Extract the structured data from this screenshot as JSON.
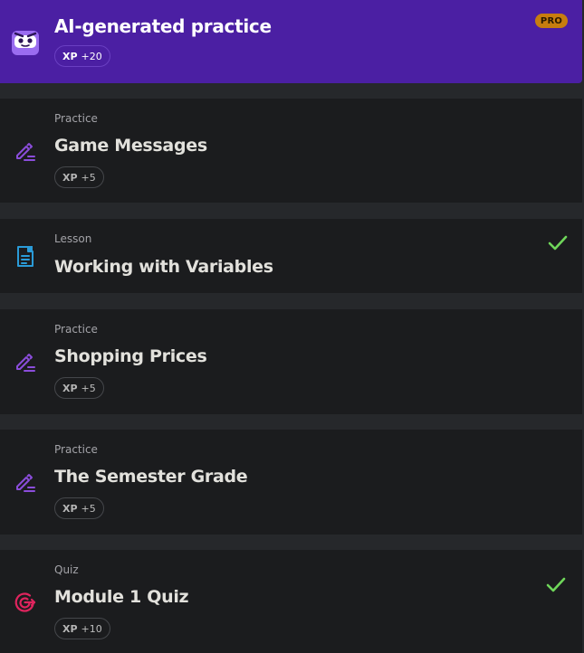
{
  "pro_card": {
    "title": "AI-generated practice",
    "xp_word": "XP",
    "xp_value": "+20",
    "pro_badge": "PRO",
    "icon": "robot-mascot-icon"
  },
  "items": [
    {
      "type": "Practice",
      "title": "Game Messages",
      "xp_word": "XP",
      "xp_value": "+5",
      "icon": "pencil-edit-icon",
      "completed": false
    },
    {
      "type": "Lesson",
      "title": "Working with Variables",
      "icon": "lesson-document-icon",
      "completed": true
    },
    {
      "type": "Practice",
      "title": "Shopping Prices",
      "xp_word": "XP",
      "xp_value": "+5",
      "icon": "pencil-edit-icon",
      "completed": false
    },
    {
      "type": "Practice",
      "title": "The Semester Grade",
      "xp_word": "XP",
      "xp_value": "+5",
      "icon": "pencil-edit-icon",
      "completed": false
    },
    {
      "type": "Quiz",
      "title": "Module 1 Quiz",
      "xp_word": "XP",
      "xp_value": "+10",
      "icon": "target-icon",
      "completed": true
    }
  ],
  "colors": {
    "background": "#26282b",
    "card": "#1b1c1e",
    "pro_card": "#4b1fa3",
    "pro_badge": "#c77d0f",
    "practice_icon": "#8b4ddb",
    "lesson_icon": "#2a9bd8",
    "quiz_icon": "#e0245e",
    "check": "#6fd65a"
  }
}
